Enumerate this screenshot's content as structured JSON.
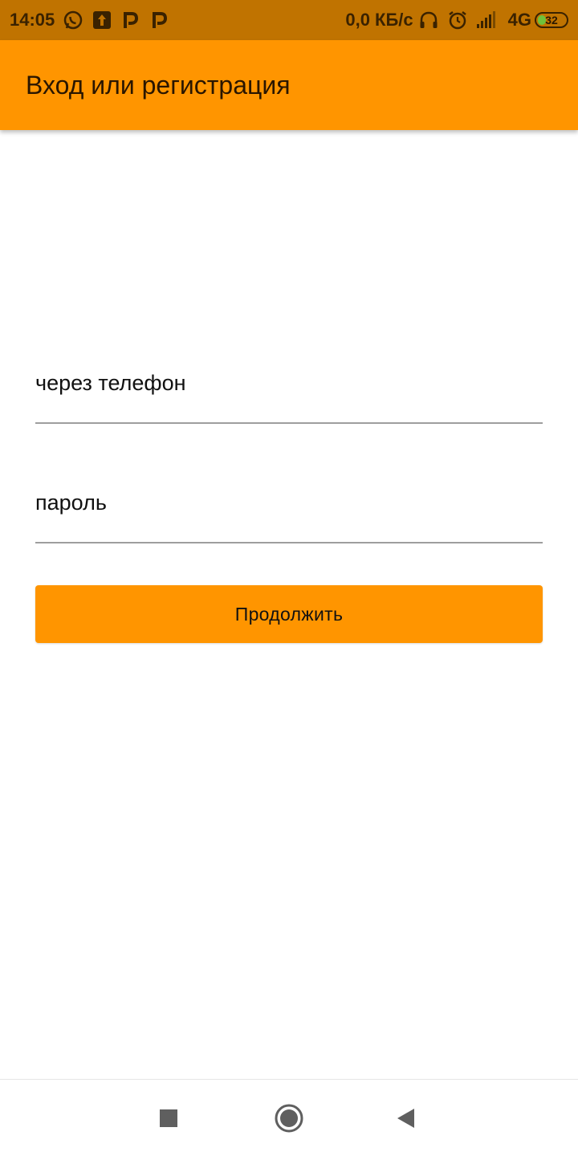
{
  "status_bar": {
    "time": "14:05",
    "left_icons": [
      "whatsapp-icon",
      "upload-icon",
      "p-app-icon",
      "p-app-icon"
    ],
    "network_speed": "0,0 КБ/с",
    "network_type": "4G",
    "battery_level": "32",
    "battery_fraction": 0.32,
    "right_icons": [
      "headphones-icon",
      "alarm-icon",
      "signal-icon"
    ]
  },
  "app_bar": {
    "title": "Вход или регистрация",
    "background_color": "#ff9500"
  },
  "form": {
    "phone_placeholder": "через телефон",
    "phone_value": "",
    "password_placeholder": "пароль",
    "password_value": "",
    "continue_label": "Продолжить",
    "button_color": "#ff9500"
  },
  "nav_bar": {
    "buttons": [
      "recents-icon",
      "home-icon",
      "back-icon"
    ]
  }
}
